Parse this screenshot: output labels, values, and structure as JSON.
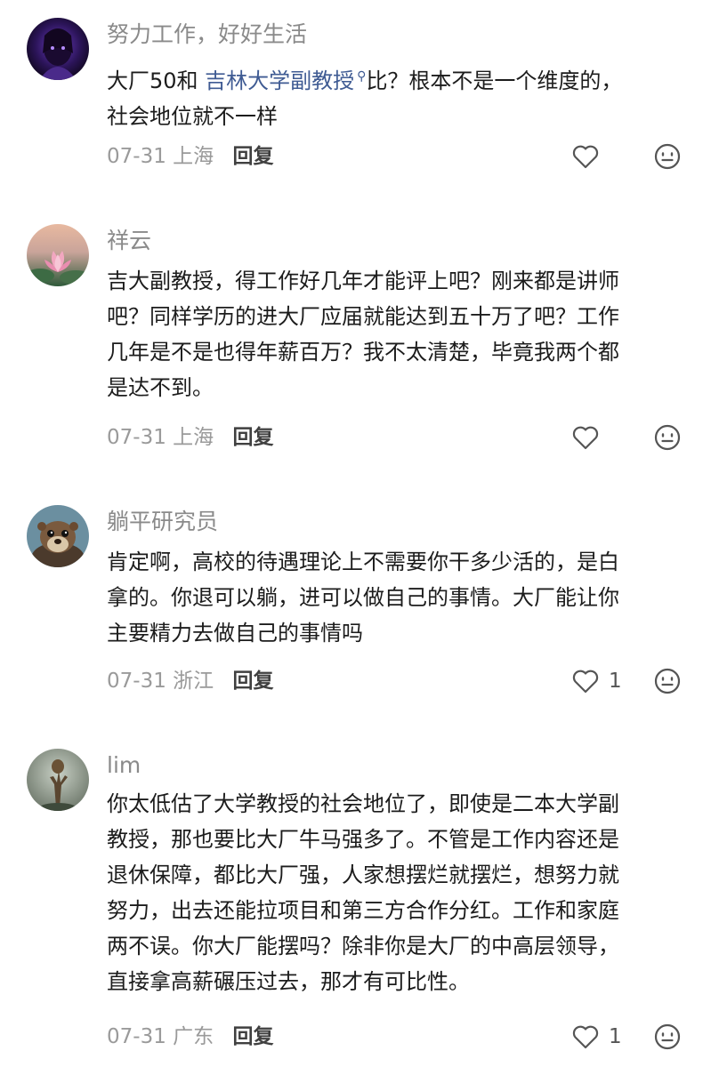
{
  "comments": [
    {
      "username": "努力工作，好好生活",
      "text_lines": [
        "大厂50和 ",
        "吉林大学副教授",
        "比？根本不是一个维度的，",
        "社会地位就不一样"
      ],
      "date": "07-31",
      "location": "上海",
      "reply_label": "回复",
      "likes": ""
    },
    {
      "username": "祥云",
      "text_lines": [
        "吉大副教授，得工作好几年才能评上吧？刚来都是讲师",
        "吧？同样学历的进大厂应届就能达到五十万了吧？工作",
        "几年是不是也得年薪百万？我不太清楚，毕竟我两个都",
        "是达不到。"
      ],
      "date": "07-31",
      "location": "上海",
      "reply_label": "回复",
      "likes": ""
    },
    {
      "username": "躺平研究员",
      "text_lines": [
        "肯定啊，高校的待遇理论上不需要你干多少活的，是白",
        "拿的。你退可以躺，进可以做自己的事情。大厂能让你",
        "主要精力去做自己的事情吗"
      ],
      "date": "07-31",
      "location": "浙江",
      "reply_label": "回复",
      "likes": "1"
    },
    {
      "username": "lim",
      "text_lines": [
        "你太低估了大学教授的社会地位了，即使是二本大学副",
        "教授，那也要比大厂牛马强多了。不管是工作内容还是",
        "退休保障，都比大厂强，人家想摆烂就摆烂，想努力就",
        "努力，出去还能拉项目和第三方合作分红。工作和家庭",
        "两不误。你大厂能摆吗？除非你是大厂的中高层领导，",
        "直接拿高薪碾压过去，那才有可比性。"
      ],
      "date": "07-31",
      "location": "广东",
      "reply_label": "回复",
      "likes": "1"
    }
  ],
  "icons": {
    "like": "heart-outline-icon",
    "react": "emoji-face-icon",
    "link_marker": "search-icon"
  },
  "colors": {
    "username": "#8a8a8a",
    "body_text": "#1c1c1c",
    "link": "#3f5b93",
    "meta": "#9a9a9a",
    "reply": "#404040",
    "icon_stroke": "#555555"
  }
}
